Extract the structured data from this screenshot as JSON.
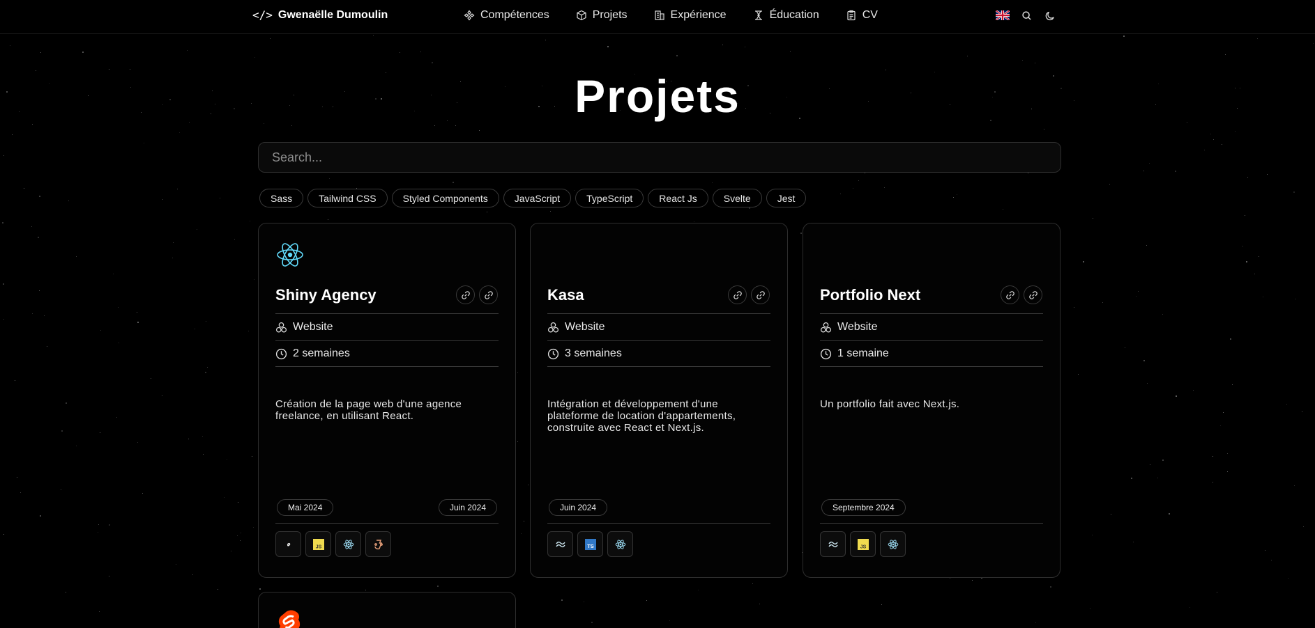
{
  "header": {
    "brand_icon": "</>",
    "brand_name": "Gwenaëlle Dumoulin",
    "nav": [
      {
        "label": "Compétences",
        "icon": "skills-icon"
      },
      {
        "label": "Projets",
        "icon": "cube-icon"
      },
      {
        "label": "Expérience",
        "icon": "building-icon"
      },
      {
        "label": "Éducation",
        "icon": "education-icon"
      },
      {
        "label": "CV",
        "icon": "document-icon"
      }
    ],
    "tools": [
      "uk-flag-icon",
      "search-icon",
      "moon-icon"
    ]
  },
  "page": {
    "title": "Projets",
    "search_placeholder": "Search..."
  },
  "filters": [
    "Sass",
    "Tailwind CSS",
    "Styled Components",
    "JavaScript",
    "TypeScript",
    "React Js",
    "Svelte",
    "Jest"
  ],
  "projects": [
    {
      "logo": "react-icon",
      "name": "Shiny Agency",
      "type": "Website",
      "duration": "2 semaines",
      "description": "Création de la page web d'une agence freelance, en utilisant React.",
      "start": "Mai 2024",
      "end": "Juin 2024",
      "techs": [
        "sass-icon",
        "javascript-icon",
        "react-icon",
        "jest-icon"
      ]
    },
    {
      "logo": "",
      "name": "Kasa",
      "type": "Website",
      "duration": "3 semaines",
      "description": "Intégration et développement d'une plateforme de location d'appartements, construite avec React et Next.js.",
      "start": "Juin 2024",
      "end": "",
      "techs": [
        "tailwind-icon",
        "typescript-icon",
        "react-icon"
      ]
    },
    {
      "logo": "",
      "name": "Portfolio Next",
      "type": "Website",
      "duration": "1 semaine",
      "description": "Un portfolio fait avec Next.js.",
      "start": "Septembre 2024",
      "end": "",
      "techs": [
        "tailwind-icon",
        "javascript-icon",
        "react-icon"
      ]
    },
    {
      "logo": "svelte-icon"
    }
  ],
  "colors": {
    "background": "#000000",
    "react": "#61DAFB",
    "svelte": "#FF3E00",
    "javascript": "#F0DB4F",
    "typescript": "#3178C6"
  }
}
